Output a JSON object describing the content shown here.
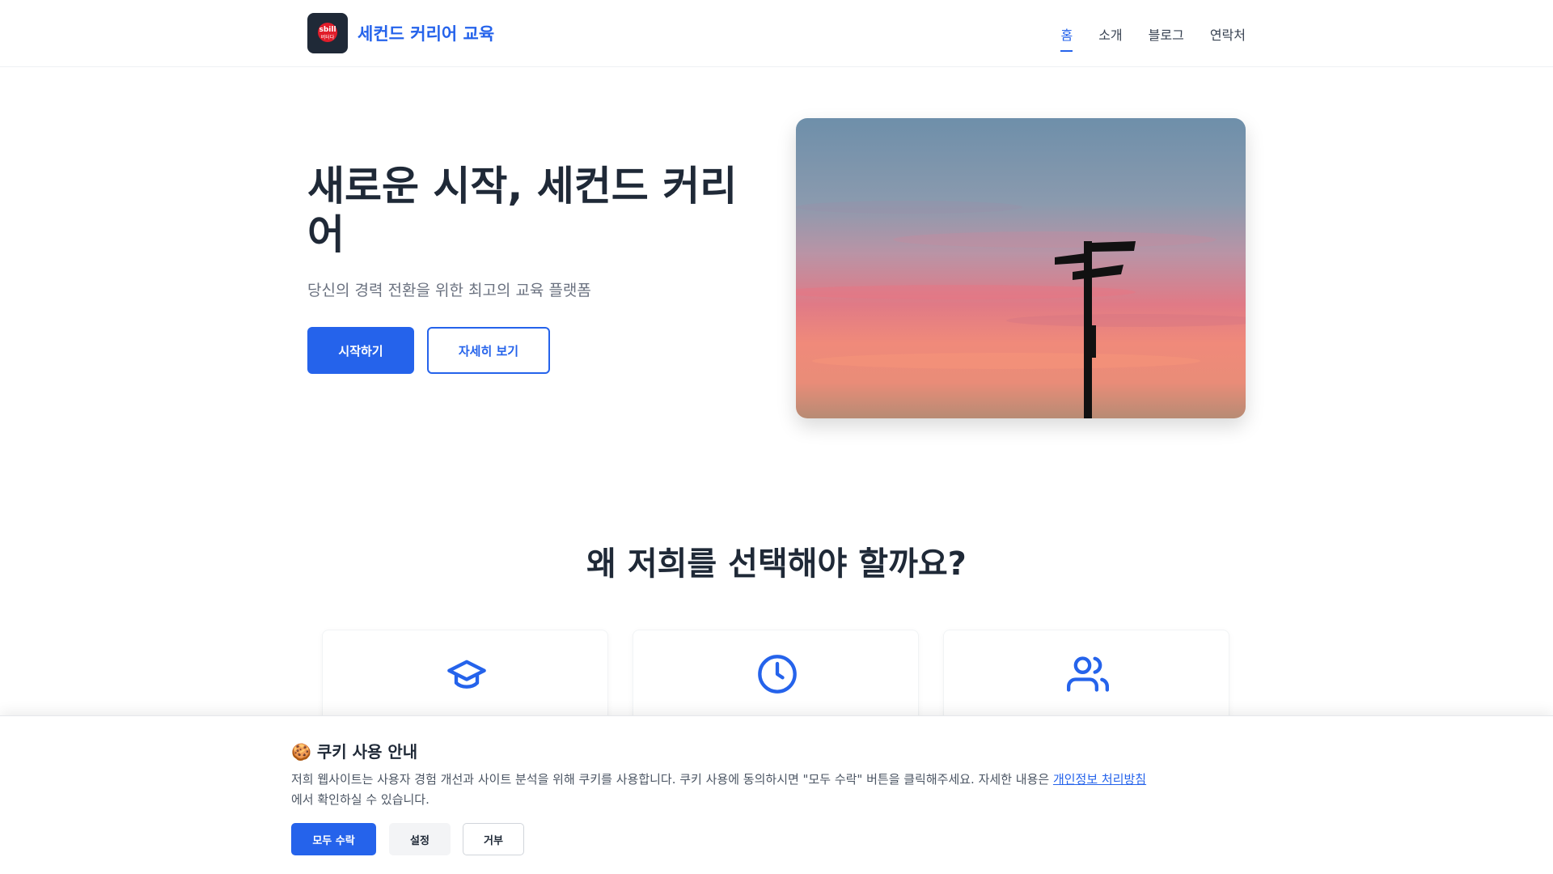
{
  "header": {
    "logo_text": "sbill",
    "logo_subtext": "버터다",
    "brand": "세컨드 커리어 교육",
    "nav": [
      {
        "label": "홈",
        "active": true
      },
      {
        "label": "소개",
        "active": false
      },
      {
        "label": "블로그",
        "active": false
      },
      {
        "label": "연락처",
        "active": false
      }
    ]
  },
  "hero": {
    "title": "새로운 시작, 세컨드 커리어",
    "subtitle": "당신의 경력 전환을 위한 최고의 교육 플랫폼",
    "primary_button": "시작하기",
    "secondary_button": "자세히 보기",
    "image": "sunset-signpost"
  },
  "features": {
    "title": "왜 저희를 선택해야 할까요?",
    "cards": [
      {
        "icon": "graduation-cap-icon"
      },
      {
        "icon": "clock-icon"
      },
      {
        "icon": "users-icon"
      }
    ]
  },
  "cookie_banner": {
    "emoji": "🍪",
    "title": "쿠키 사용 안내",
    "text": "저희 웹사이트는 사용자 경험 개선과 사이트 분석을 위해 쿠키를 사용합니다. 쿠키 사용에 동의하시면 \"모두 수락\" 버튼을 클릭해주세요. 자세한 내용은 ",
    "link": "개인정보 처리방침",
    "text_after": "에서 확인하실 수 있습니다.",
    "accept": "모두 수락",
    "settings": "설정",
    "reject": "거부"
  },
  "colors": {
    "accent": "#2563eb",
    "text": "#1f2937",
    "muted": "#6b7280"
  }
}
